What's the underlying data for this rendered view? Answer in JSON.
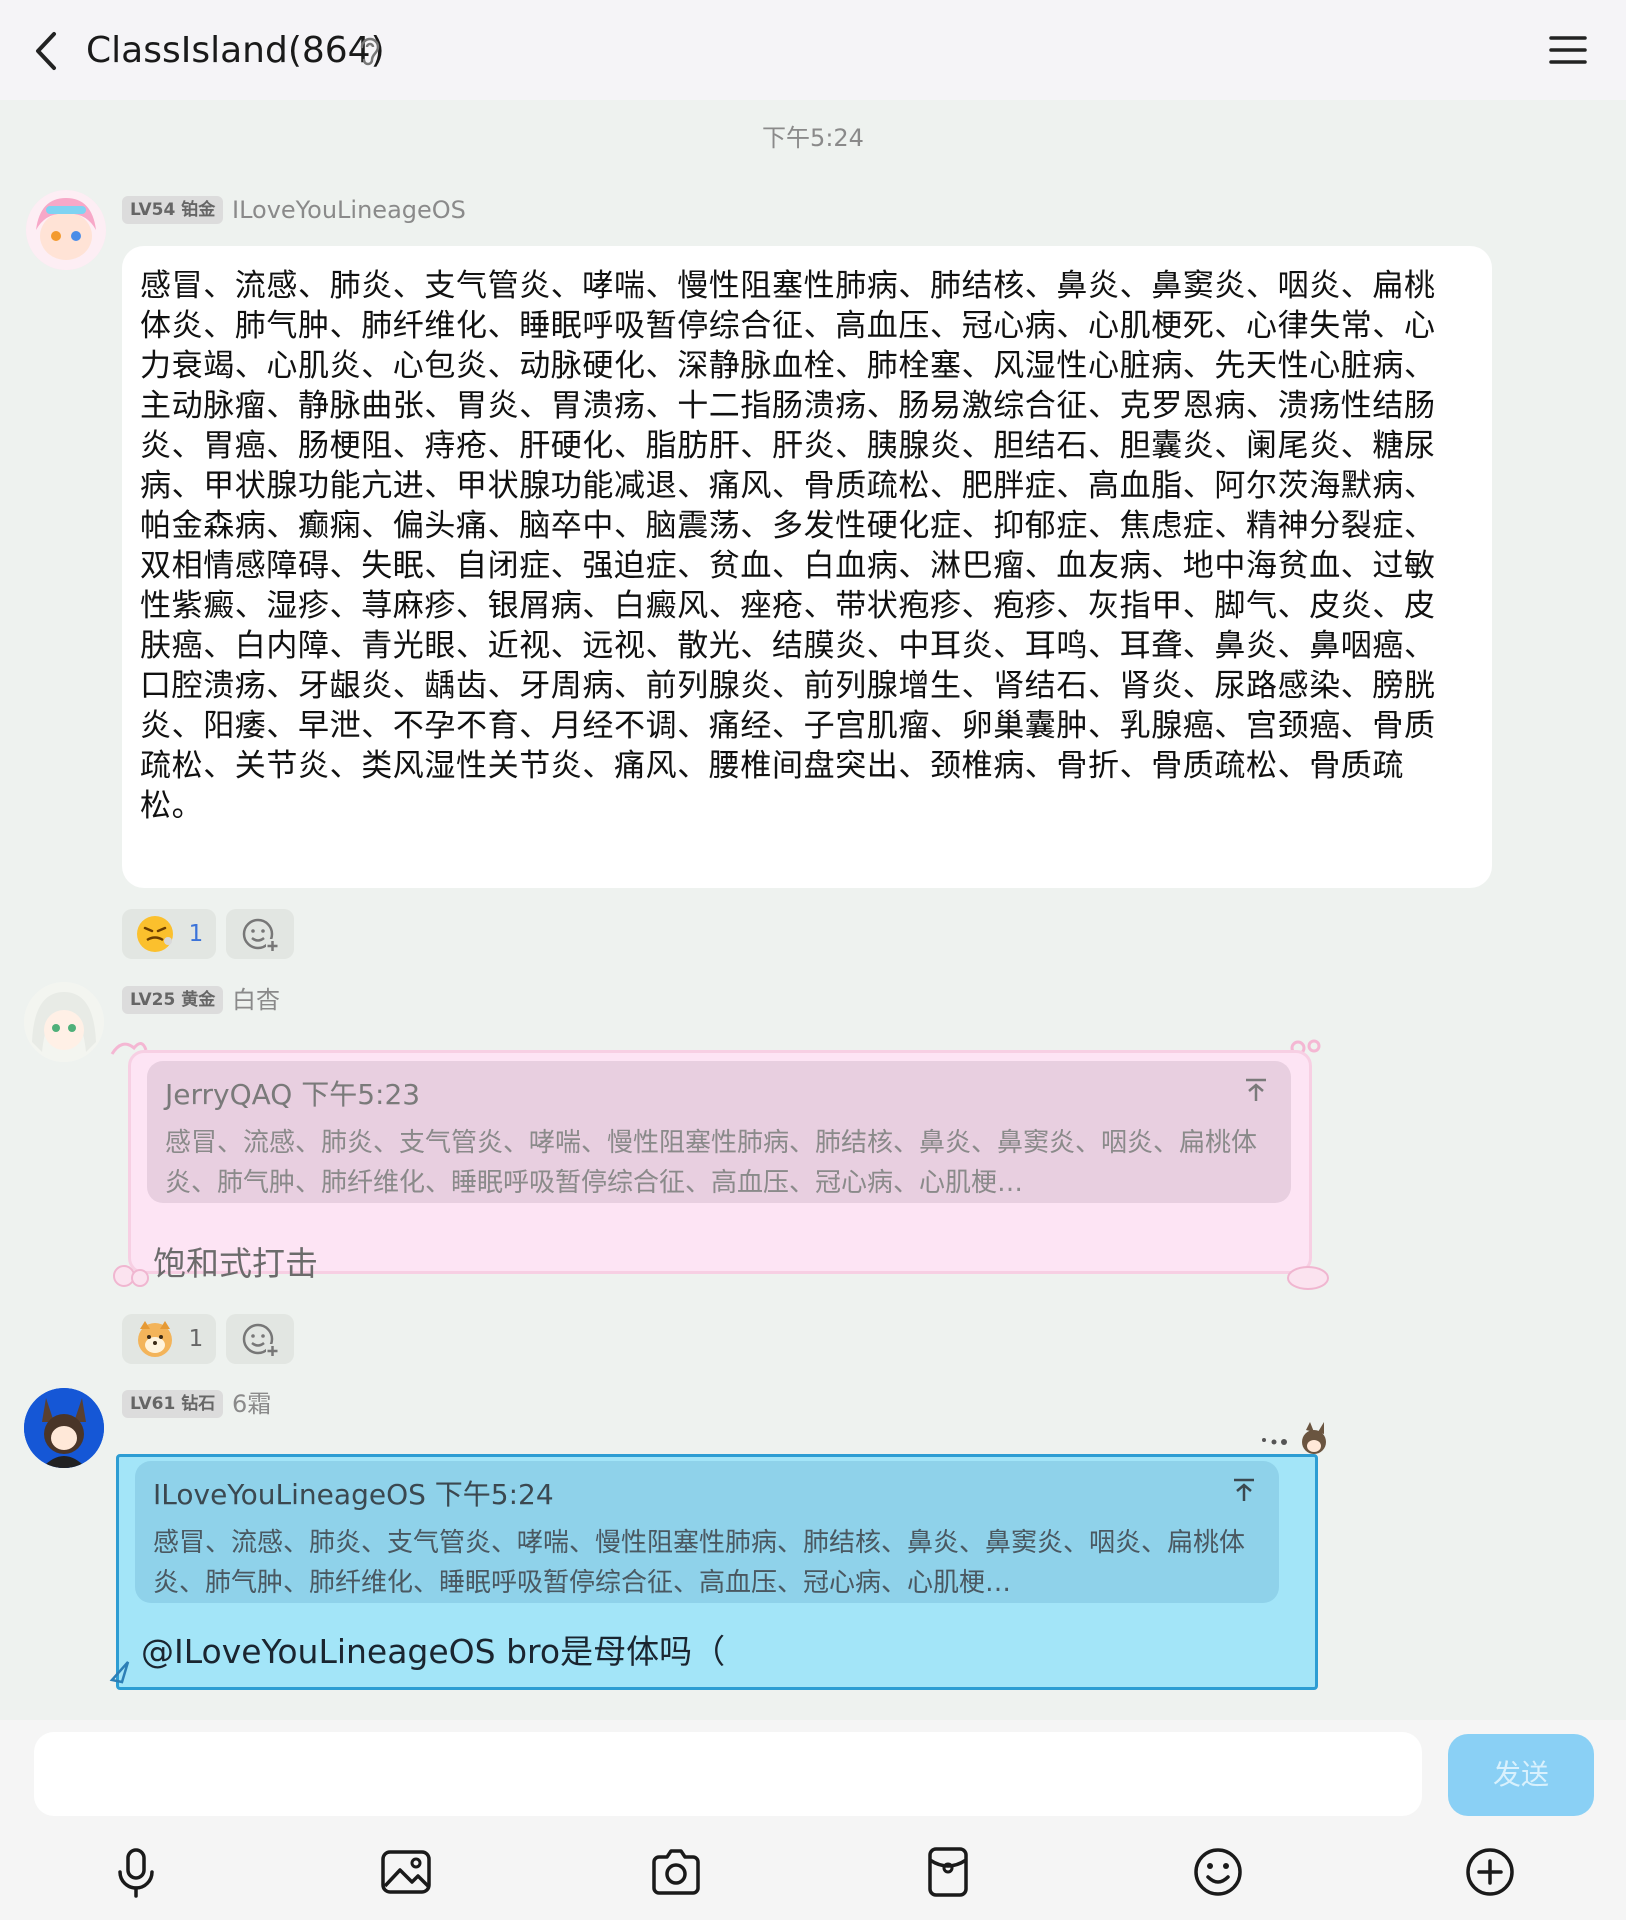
{
  "header": {
    "title": "ClassIsland(864)"
  },
  "timestamp": "下午5:24",
  "messages": [
    {
      "badge": "LV54 铂金",
      "nickname": "ILoveYouLineageOS",
      "text": "感冒、流感、肺炎、支气管炎、哮喘、慢性阻塞性肺病、肺结核、鼻炎、鼻窦炎、咽炎、扁桃体炎、肺气肿、肺纤维化、睡眠呼吸暂停综合征、高血压、冠心病、心肌梗死、心律失常、心力衰竭、心肌炎、心包炎、动脉硬化、深静脉血栓、肺栓塞、风湿性心脏病、先天性心脏病、主动脉瘤、静脉曲张、胃炎、胃溃疡、十二指肠溃疡、肠易激综合征、克罗恩病、溃疡性结肠炎、胃癌、肠梗阻、痔疮、肝硬化、脂肪肝、肝炎、胰腺炎、胆结石、胆囊炎、阑尾炎、糖尿病、甲状腺功能亢进、甲状腺功能减退、痛风、骨质疏松、肥胖症、高血脂、阿尔茨海默病、帕金森病、癫痫、偏头痛、脑卒中、脑震荡、多发性硬化症、抑郁症、焦虑症、精神分裂症、双相情感障碍、失眠、自闭症、强迫症、贫血、白血病、淋巴瘤、血友病、地中海贫血、过敏性紫癜、湿疹、荨麻疹、银屑病、白癜风、痤疮、带状疱疹、疱疹、灰指甲、脚气、皮炎、皮肤癌、白内障、青光眼、近视、远视、散光、结膜炎、中耳炎、耳鸣、耳聋、鼻炎、鼻咽癌、口腔溃疡、牙龈炎、龋齿、牙周病、前列腺炎、前列腺增生、肾结石、肾炎、尿路感染、膀胱炎、阳痿、早泄、不孕不育、月经不调、痛经、子宫肌瘤、卵巢囊肿、乳腺癌、宫颈癌、骨质疏松、关节炎、类风湿性关节炎、痛风、腰椎间盘突出、颈椎病、骨折、骨质疏松、骨质疏松。",
      "reaction_count": "1"
    },
    {
      "badge": "LV25 黄金",
      "nickname": "白杳",
      "quote_author": "JerryQAQ 下午5:23",
      "quote_text": "感冒、流感、肺炎、支气管炎、哮喘、慢性阻塞性肺病、肺结核、鼻炎、鼻窦炎、咽炎、扁桃体炎、肺气肿、肺纤维化、睡眠呼吸暂停综合征、高血压、冠心病、心肌梗…",
      "text": "饱和式打击",
      "reaction_count": "1"
    },
    {
      "badge": "LV61 钻石",
      "nickname": "6霜",
      "quote_author": "ILoveYouLineageOS 下午5:24",
      "quote_text": "感冒、流感、肺炎、支气管炎、哮喘、慢性阻塞性肺病、肺结核、鼻炎、鼻窦炎、咽炎、扁桃体炎、肺气肿、肺纤维化、睡眠呼吸暂停综合征、高血压、冠心病、心肌梗…",
      "text": "@ILoveYouLineageOS bro是母体吗（"
    }
  ],
  "input": {
    "send_label": "发送"
  },
  "icons": {
    "toolbar": [
      "microphone-icon",
      "image-icon",
      "camera-icon",
      "red-packet-icon",
      "emoji-icon",
      "plus-icon"
    ]
  },
  "colors": {
    "send": "#8ad0f5",
    "bubble_pink": "#fde4f4",
    "bubble_blue": "#a3e5f8"
  }
}
